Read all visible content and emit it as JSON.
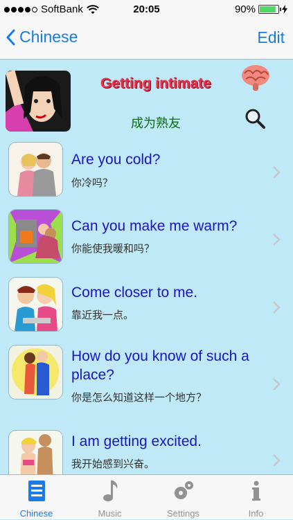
{
  "status_bar": {
    "carrier": "SoftBank",
    "time": "20:05",
    "battery": "90%",
    "battery_level": 0.9
  },
  "nav": {
    "back_label": "Chinese",
    "edit_label": "Edit"
  },
  "lesson": {
    "title": "Getting intimate",
    "subtitle": "成为熟友"
  },
  "phrases": [
    {
      "english": "Are you cold?",
      "chinese": "你冷吗？"
    },
    {
      "english": "Can you make me warm?",
      "chinese": "你能使我暖和吗？"
    },
    {
      "english": "Come closer to me.",
      "chinese": "靠近我一点。"
    },
    {
      "english": "How do you know of such a place?",
      "chinese": "你是怎么知道这样一个地方？"
    },
    {
      "english": "I am getting excited.",
      "chinese": "我开始感到兴奋。"
    }
  ],
  "tabs": [
    {
      "label": "Chinese",
      "icon": "list-icon",
      "active": true
    },
    {
      "label": "Music",
      "icon": "music-note-icon",
      "active": false
    },
    {
      "label": "Settings",
      "icon": "gears-icon",
      "active": false
    },
    {
      "label": "Info",
      "icon": "info-icon",
      "active": false
    }
  ],
  "colors": {
    "accent": "#1a7ae6",
    "background": "#bfe9f7",
    "phrase_text": "#1a14c8",
    "title": "#e0304a"
  }
}
